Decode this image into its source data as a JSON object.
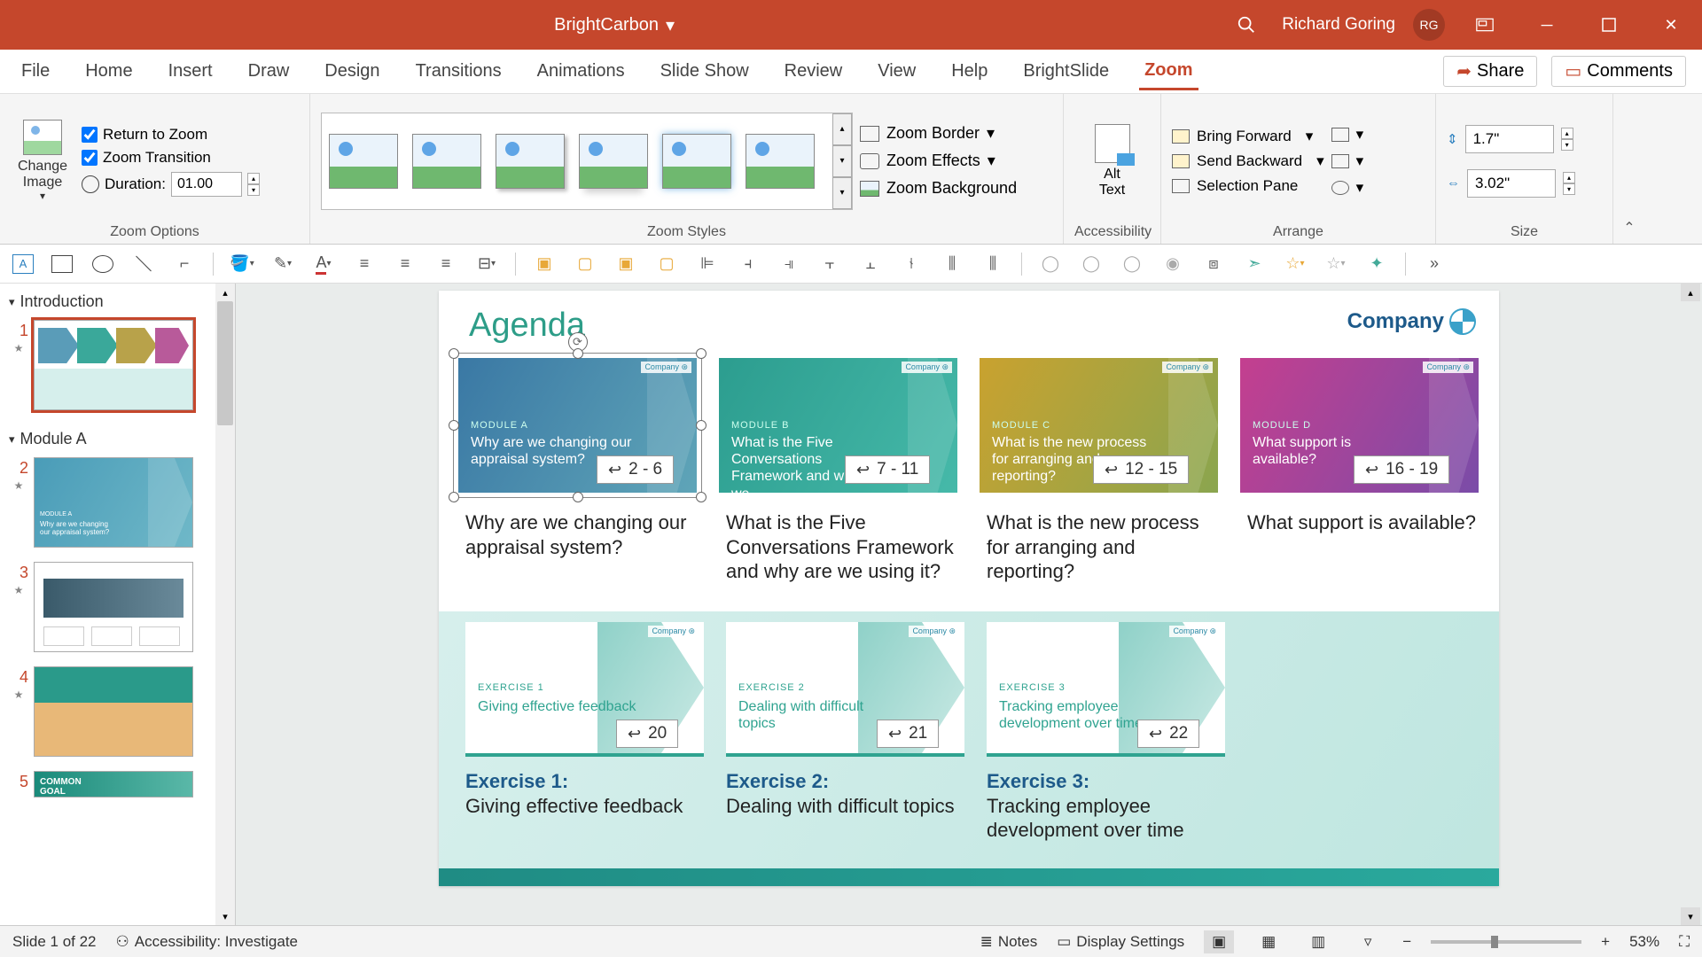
{
  "titlebar": {
    "doc_name": "BrightCarbon",
    "user_name": "Richard Goring",
    "user_initials": "RG"
  },
  "ribbon": {
    "tabs": [
      "File",
      "Home",
      "Insert",
      "Draw",
      "Design",
      "Transitions",
      "Animations",
      "Slide Show",
      "Review",
      "View",
      "Help",
      "BrightSlide",
      "Zoom"
    ],
    "active_tab": "Zoom",
    "share": "Share",
    "comments": "Comments",
    "groups": {
      "change_image": "Change\nImage",
      "zoom_options_label": "Zoom Options",
      "return_to_zoom": "Return to Zoom",
      "zoom_transition": "Zoom Transition",
      "duration_label": "Duration:",
      "duration_value": "01.00",
      "zoom_styles_label": "Zoom Styles",
      "zoom_border": "Zoom Border",
      "zoom_effects": "Zoom Effects",
      "zoom_background": "Zoom Background",
      "accessibility_label": "Accessibility",
      "alt_text": "Alt\nText",
      "arrange_label": "Arrange",
      "bring_forward": "Bring Forward",
      "send_backward": "Send Backward",
      "selection_pane": "Selection Pane",
      "size_label": "Size",
      "height": "1.7\"",
      "width": "3.02\""
    }
  },
  "thumbnails": {
    "section1": "Introduction",
    "section2": "Module A",
    "slides": [
      {
        "num": "1"
      },
      {
        "num": "2"
      },
      {
        "num": "3"
      },
      {
        "num": "4"
      },
      {
        "num": "5"
      }
    ]
  },
  "slide": {
    "title": "Agenda",
    "company": "Company",
    "modules": [
      {
        "code": "MODULE A",
        "text": "Why are we changing our appraisal system?",
        "range": "2 - 6",
        "caption": "Why are we changing our appraisal system?"
      },
      {
        "code": "MODULE B",
        "text": "What is the Five Conversations Framework and why are we",
        "range": "7 - 11",
        "caption": "What is the Five Conversations Framework and why are we using it?"
      },
      {
        "code": "MODULE C",
        "text": "What is the new process for arranging and reporting?",
        "range": "12 - 15",
        "caption": "What is the new process for arranging and reporting?"
      },
      {
        "code": "MODULE D",
        "text": "What support is available?",
        "range": "16 - 19",
        "caption": "What support is available?"
      }
    ],
    "exercises": [
      {
        "code": "EXERCISE 1",
        "text": "Giving effective feedback",
        "range": "20",
        "head": "Exercise 1:",
        "caption": "Giving effective feedback"
      },
      {
        "code": "EXERCISE 2",
        "text": "Dealing with difficult topics",
        "range": "21",
        "head": "Exercise 2:",
        "caption": "Dealing with difficult topics"
      },
      {
        "code": "EXERCISE 3",
        "text": "Tracking employee development over time",
        "range": "22",
        "head": "Exercise 3:",
        "caption": "Tracking employee development over time"
      }
    ]
  },
  "status": {
    "slide_pos": "Slide 1 of 22",
    "accessibility": "Accessibility: Investigate",
    "notes": "Notes",
    "display": "Display Settings",
    "zoom_pct": "53%"
  }
}
